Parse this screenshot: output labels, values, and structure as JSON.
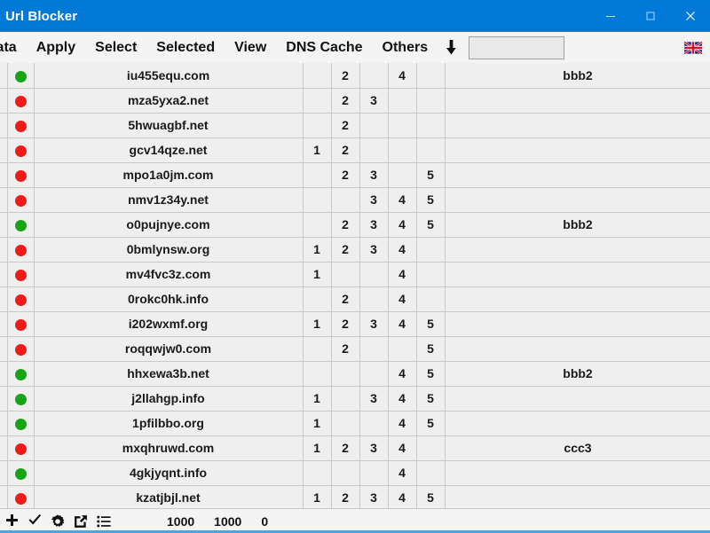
{
  "window": {
    "title": "Url Blocker",
    "titlebar_color": "#0079d7",
    "controls": {
      "minimize": "minimize-icon",
      "maximize": "maximize-icon",
      "close": "close-icon"
    }
  },
  "menubar": {
    "items": [
      {
        "label": "Data"
      },
      {
        "label": "Apply"
      },
      {
        "label": "Select"
      },
      {
        "label": "Selected"
      },
      {
        "label": "View"
      },
      {
        "label": "DNS Cache"
      },
      {
        "label": "Others"
      }
    ],
    "sort_arrow_icon": "arrow-down-icon",
    "search": {
      "value": "",
      "placeholder": ""
    },
    "language_flag_icon": "uk-flag-icon"
  },
  "table": {
    "rows": [
      {
        "status": "green",
        "url": "iu455equ.com",
        "c1": "",
        "c2": "2",
        "c3": "",
        "c4": "4",
        "c5": "",
        "tag": "bbb2"
      },
      {
        "status": "red",
        "url": "mza5yxa2.net",
        "c1": "",
        "c2": "2",
        "c3": "3",
        "c4": "",
        "c5": "",
        "tag": ""
      },
      {
        "status": "red",
        "url": "5hwuagbf.net",
        "c1": "",
        "c2": "2",
        "c3": "",
        "c4": "",
        "c5": "",
        "tag": ""
      },
      {
        "status": "red",
        "url": "gcv14qze.net",
        "c1": "1",
        "c2": "2",
        "c3": "",
        "c4": "",
        "c5": "",
        "tag": ""
      },
      {
        "status": "red",
        "url": "mpo1a0jm.com",
        "c1": "",
        "c2": "2",
        "c3": "3",
        "c4": "",
        "c5": "5",
        "tag": ""
      },
      {
        "status": "red",
        "url": "nmv1z34y.net",
        "c1": "",
        "c2": "",
        "c3": "3",
        "c4": "4",
        "c5": "5",
        "tag": ""
      },
      {
        "status": "green",
        "url": "o0pujnye.com",
        "c1": "",
        "c2": "2",
        "c3": "3",
        "c4": "4",
        "c5": "5",
        "tag": "bbb2"
      },
      {
        "status": "red",
        "url": "0bmlynsw.org",
        "c1": "1",
        "c2": "2",
        "c3": "3",
        "c4": "4",
        "c5": "",
        "tag": ""
      },
      {
        "status": "red",
        "url": "mv4fvc3z.com",
        "c1": "1",
        "c2": "",
        "c3": "",
        "c4": "4",
        "c5": "",
        "tag": ""
      },
      {
        "status": "red",
        "url": "0rokc0hk.info",
        "c1": "",
        "c2": "2",
        "c3": "",
        "c4": "4",
        "c5": "",
        "tag": ""
      },
      {
        "status": "red",
        "url": "i202wxmf.org",
        "c1": "1",
        "c2": "2",
        "c3": "3",
        "c4": "4",
        "c5": "5",
        "tag": ""
      },
      {
        "status": "red",
        "url": "roqqwjw0.com",
        "c1": "",
        "c2": "2",
        "c3": "",
        "c4": "",
        "c5": "5",
        "tag": ""
      },
      {
        "status": "green",
        "url": "hhxewa3b.net",
        "c1": "",
        "c2": "",
        "c3": "",
        "c4": "4",
        "c5": "5",
        "tag": "bbb2"
      },
      {
        "status": "green",
        "url": "j2llahgp.info",
        "c1": "1",
        "c2": "",
        "c3": "3",
        "c4": "4",
        "c5": "5",
        "tag": ""
      },
      {
        "status": "green",
        "url": "1pfilbbo.org",
        "c1": "1",
        "c2": "",
        "c3": "",
        "c4": "4",
        "c5": "5",
        "tag": ""
      },
      {
        "status": "red",
        "url": "mxqhruwd.com",
        "c1": "1",
        "c2": "2",
        "c3": "3",
        "c4": "4",
        "c5": "",
        "tag": "ccc3"
      },
      {
        "status": "green",
        "url": "4gkjyqnt.info",
        "c1": "",
        "c2": "",
        "c3": "",
        "c4": "4",
        "c5": "",
        "tag": ""
      },
      {
        "status": "red",
        "url": "kzatjbjl.net",
        "c1": "1",
        "c2": "2",
        "c3": "3",
        "c4": "4",
        "c5": "5",
        "tag": ""
      }
    ]
  },
  "statusbar": {
    "icons": [
      {
        "name": "add-icon"
      },
      {
        "name": "check-icon"
      },
      {
        "name": "settings-gear-icon"
      },
      {
        "name": "export-icon"
      },
      {
        "name": "list-icon"
      }
    ],
    "counters": [
      "1000",
      "1000",
      "0"
    ]
  },
  "colors": {
    "accent": "#0079d7",
    "status_green": "#16a516",
    "status_red": "#ee1b1b",
    "grid_bg": "#efefef"
  }
}
